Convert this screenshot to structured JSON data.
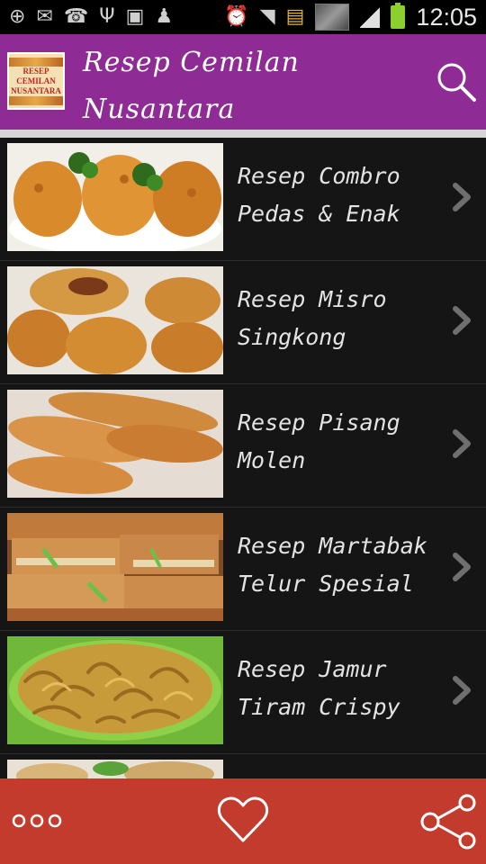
{
  "app": {
    "title": "Resep Cemilan Nusantara",
    "logo_text_line1": "RESEP",
    "logo_text_line2": "CEMILAN",
    "logo_text_line3": "NUSANTARA"
  },
  "status_bar": {
    "time": "12:05",
    "left_icons": [
      "add-icon",
      "mail-icon",
      "whatsapp-icon",
      "usb-icon",
      "image-icon",
      "bookmark-icon"
    ],
    "right_icons": [
      "alarm-icon",
      "wifi-icon",
      "file-icon",
      "signal-icon",
      "battery-icon"
    ]
  },
  "recipes": [
    {
      "label": "Resep Combro Pedas & Enak",
      "thumb_icon": "combro-photo"
    },
    {
      "label": "Resep Misro Singkong",
      "thumb_icon": "misro-photo"
    },
    {
      "label": "Resep Pisang Molen",
      "thumb_icon": "pisang-molen-photo"
    },
    {
      "label": "Resep Martabak Telur Spesial",
      "thumb_icon": "martabak-photo"
    },
    {
      "label": "Resep Jamur Tiram Crispy",
      "thumb_icon": "jamur-photo"
    },
    {
      "label": "",
      "thumb_icon": "partial-photo"
    }
  ],
  "colors": {
    "appbar": "#8e2b94",
    "bottombar": "#c33b2d",
    "list_bg": "#151515"
  },
  "bottom_nav": [
    "more-icon",
    "heart-icon",
    "share-icon"
  ]
}
